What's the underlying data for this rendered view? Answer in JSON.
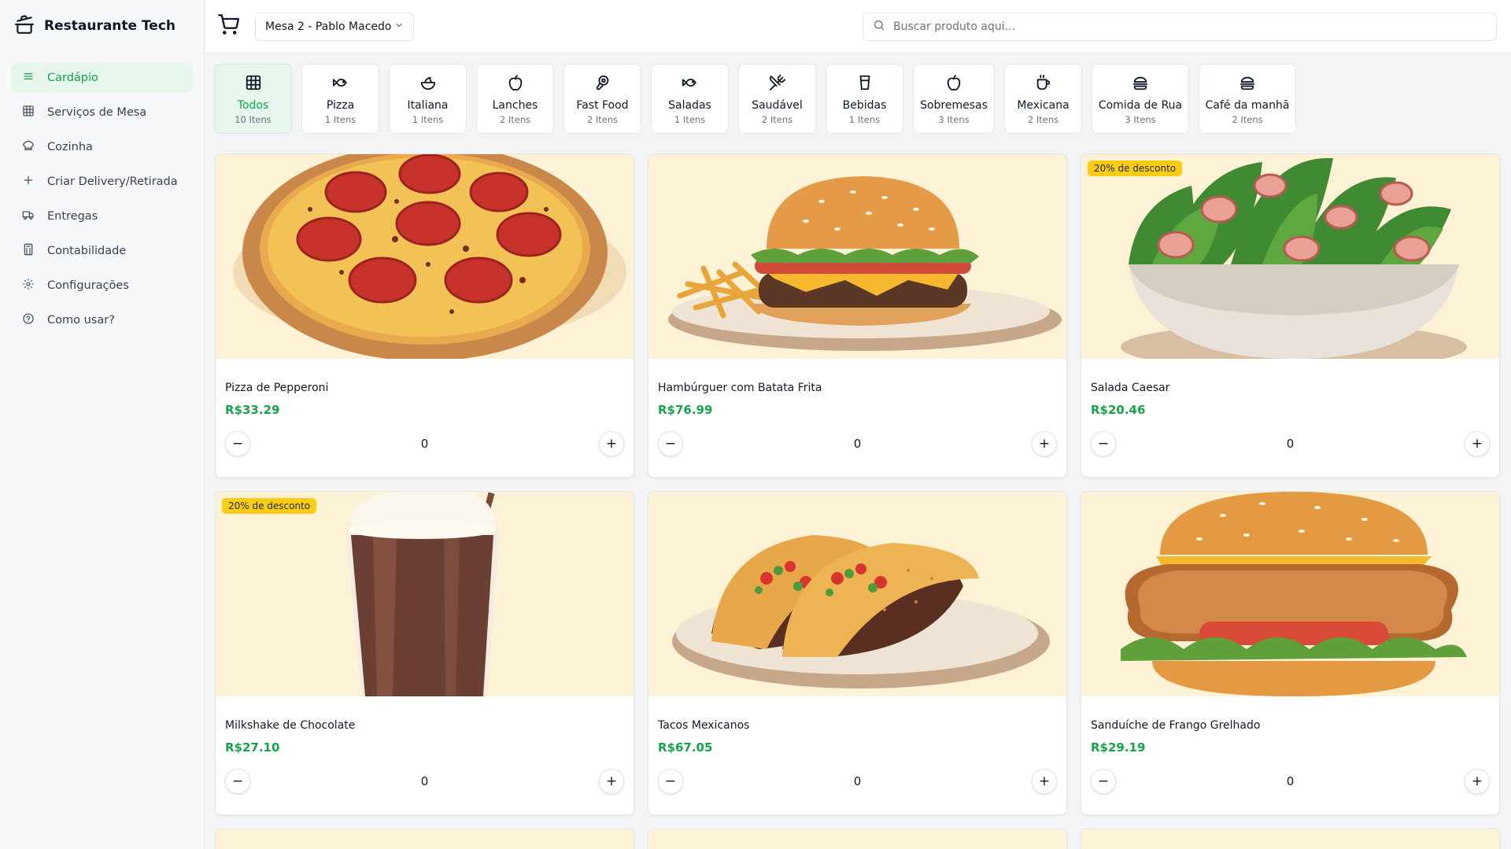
{
  "app": {
    "brand": "Restaurante Tech"
  },
  "sidebar": {
    "items": [
      {
        "label": "Cardápio",
        "icon": "menu-lines-icon",
        "active": true
      },
      {
        "label": "Serviços de Mesa",
        "icon": "table-grid-icon"
      },
      {
        "label": "Cozinha",
        "icon": "chef-hat-icon"
      },
      {
        "label": "Criar Delivery/Retirada",
        "icon": "plus-icon"
      },
      {
        "label": "Entregas",
        "icon": "truck-icon"
      },
      {
        "label": "Contabilidade",
        "icon": "calculator-icon"
      },
      {
        "label": "Configurações",
        "icon": "gear-icon"
      },
      {
        "label": "Como usar?",
        "icon": "help-circle-icon"
      }
    ]
  },
  "topbar": {
    "table_select": "Mesa 2 - Pablo Macedo",
    "search_placeholder": "Buscar produto aqui..."
  },
  "categories": [
    {
      "name": "Todos",
      "count": "10 Itens",
      "icon": "grid-icon",
      "active": true
    },
    {
      "name": "Pizza",
      "count": "1 Itens",
      "icon": "fish-icon"
    },
    {
      "name": "Italiana",
      "count": "1 Itens",
      "icon": "salad-bowl-icon"
    },
    {
      "name": "Lanches",
      "count": "2 Itens",
      "icon": "apple-icon"
    },
    {
      "name": "Fast Food",
      "count": "2 Itens",
      "icon": "beef-icon"
    },
    {
      "name": "Saladas",
      "count": "1 Itens",
      "icon": "fish-icon"
    },
    {
      "name": "Saudável",
      "count": "2 Itens",
      "icon": "utensils-crossed-icon"
    },
    {
      "name": "Bebidas",
      "count": "1 Itens",
      "icon": "cup-icon"
    },
    {
      "name": "Sobremesas",
      "count": "3 Itens",
      "icon": "apple-icon"
    },
    {
      "name": "Mexicana",
      "count": "2 Itens",
      "icon": "coffee-icon"
    },
    {
      "name": "Comida de Rua",
      "count": "3 Itens",
      "icon": "burger-icon"
    },
    {
      "name": "Café da manhã",
      "count": "2 Itens",
      "icon": "burger-icon"
    }
  ],
  "products": [
    {
      "name": "Pizza de Pepperoni",
      "price": "R$33.29",
      "qty": "0",
      "badge": "",
      "image": "pizza"
    },
    {
      "name": "Hambúrguer com Batata Frita",
      "price": "R$76.99",
      "qty": "0",
      "badge": "",
      "image": "burger"
    },
    {
      "name": "Salada Caesar",
      "price": "R$20.46",
      "qty": "0",
      "badge": "20% de desconto",
      "image": "salad"
    },
    {
      "name": "Milkshake de Chocolate",
      "price": "R$27.10",
      "qty": "0",
      "badge": "20% de desconto",
      "image": "milkshake"
    },
    {
      "name": "Tacos Mexicanos",
      "price": "R$67.05",
      "qty": "0",
      "badge": "",
      "image": "tacos"
    },
    {
      "name": "Sanduíche de Frango Grelhado",
      "price": "R$29.19",
      "qty": "0",
      "badge": "",
      "image": "sandwich"
    }
  ],
  "stepper": {
    "minus": "−",
    "plus": "+"
  },
  "colors": {
    "accent": "#16a34a",
    "active_bg": "#e6f6ec",
    "badge": "#facc15",
    "image_bg": "#fdf1d6"
  }
}
